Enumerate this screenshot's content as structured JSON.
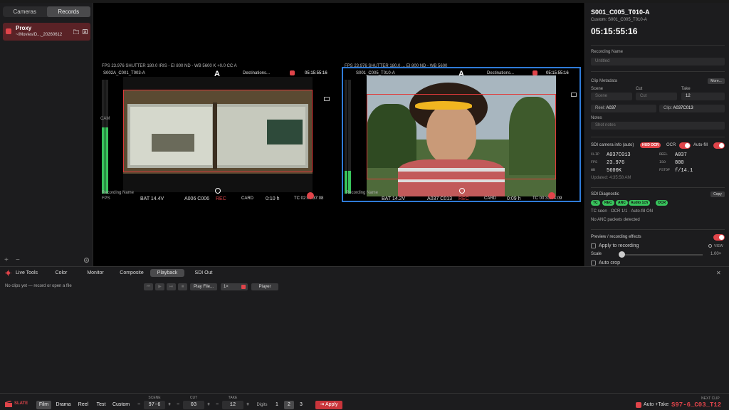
{
  "sidebar": {
    "tabs": [
      "Cameras",
      "Records"
    ],
    "record": {
      "title": "Proxy",
      "path": "~/Movies/D..._20260612"
    },
    "add": "+",
    "remove": "−"
  },
  "monitors": [
    {
      "name": "S002A_C001_T003-A",
      "label": "A",
      "dest": "Destinations...",
      "tc_top": "05:15:55:16",
      "top_info": "FPS 23.976   SHUTTER 180.0   IRIS -            EI 800   ND -   WB 5600 K  +0.0 CC  A",
      "bat": "BAT 14.4V",
      "clip": "A006 C006",
      "rec": "REC",
      "card": "CARD",
      "card_val": "0:10 h",
      "tc": "TC 02:04:37:08",
      "rec_name": "Recording Name",
      "fps": "FPS",
      "cam": "CAM"
    },
    {
      "name": "S001_C005_T010-A",
      "label": "A",
      "dest": "Destinations...",
      "tc_top": "05:15:55:16",
      "top_info": "FPS 23.976   SHUTTER 180.0 ...  EI 800  ND -   WB 5600",
      "bat": "BAT 14.2V",
      "clip": "A037 C013",
      "rec": "REC",
      "card": "CARD",
      "card_val": "0:09 h",
      "tc": "TC 00:33:44:09",
      "rec_name": "Recording Name",
      "fps": "FPS",
      "cam": "CAM"
    }
  ],
  "inspector": {
    "title": "S001_C005_T010-A",
    "custom": "Custom: S001_C005_T010-A",
    "timecode": "05:15:55:16",
    "recording_name_label": "Recording Name",
    "recording_name_placeholder": "Untitled",
    "clip_meta_label": "Clip Metadata",
    "more": "More...",
    "scene_label": "Scene",
    "cut_label": "Cut",
    "take_label": "Take",
    "scene_ph": "Scene",
    "cut_ph": "Cut",
    "take_val": "12",
    "reel_label": "Reel:",
    "reel_val": "A037",
    "clip_label": "Clip:",
    "clip_val": "A037C013",
    "notes_label": "Notes",
    "notes_ph": "Shot notes",
    "sdi_info_label": "SDI camera info (auto)",
    "hud_ocr": "HUD OCR",
    "ocr": "OCR",
    "autofill": "Auto-fill",
    "kv": [
      [
        "CLIP",
        "A037C013",
        "REEL",
        "A037"
      ],
      [
        "FPS",
        "23.976",
        "ISO",
        "800"
      ],
      [
        "WB",
        "5600K",
        "FSTOP",
        "f/14.1"
      ]
    ],
    "updated": "Updated: 4:35:58 AM",
    "diag_label": "SDI Diagnostic",
    "copy": "Copy",
    "pills": [
      "TC",
      "REC",
      "ANC",
      "Audio 1ch",
      "OCR"
    ],
    "tc_seen": "TC seen · OCR 1/1 · Auto-fill ON",
    "no_anc": "No ANC packets detected",
    "preview_label": "Preview / recording effects",
    "apply_label": "Apply to recording",
    "view_label": "VIEW",
    "scale_label": "Scale",
    "scale_val": "1.00×",
    "autocrop_label": "Auto crop"
  },
  "tools": {
    "title": "Live Tools",
    "tabs": [
      "Color",
      "Monitor",
      "Composite",
      "Playback",
      "SDI Out"
    ],
    "empty": "No clips yet — record or open a file",
    "play_file": "Play File...",
    "speed": "1×",
    "player": "Player",
    "close": "✕"
  },
  "slate": {
    "label": "SLATE",
    "modes": [
      "Film",
      "Drama",
      "Reel",
      "Test",
      "Custom"
    ],
    "scene_label": "SCENE",
    "scene": "97-6",
    "cut_label": "CUT",
    "cut": "03",
    "take_label": "TAKE",
    "take": "12",
    "digits_label": "Digits",
    "digits": [
      "1",
      "2",
      "3"
    ],
    "apply": "Apply",
    "autotake": "Auto +Take",
    "next_label": "NEXT CLIP",
    "next": "S97-6_C03_T12"
  },
  "colors": {
    "accent": "#e0444a",
    "select": "#2f7bd8",
    "meter": "#38c45c"
  }
}
